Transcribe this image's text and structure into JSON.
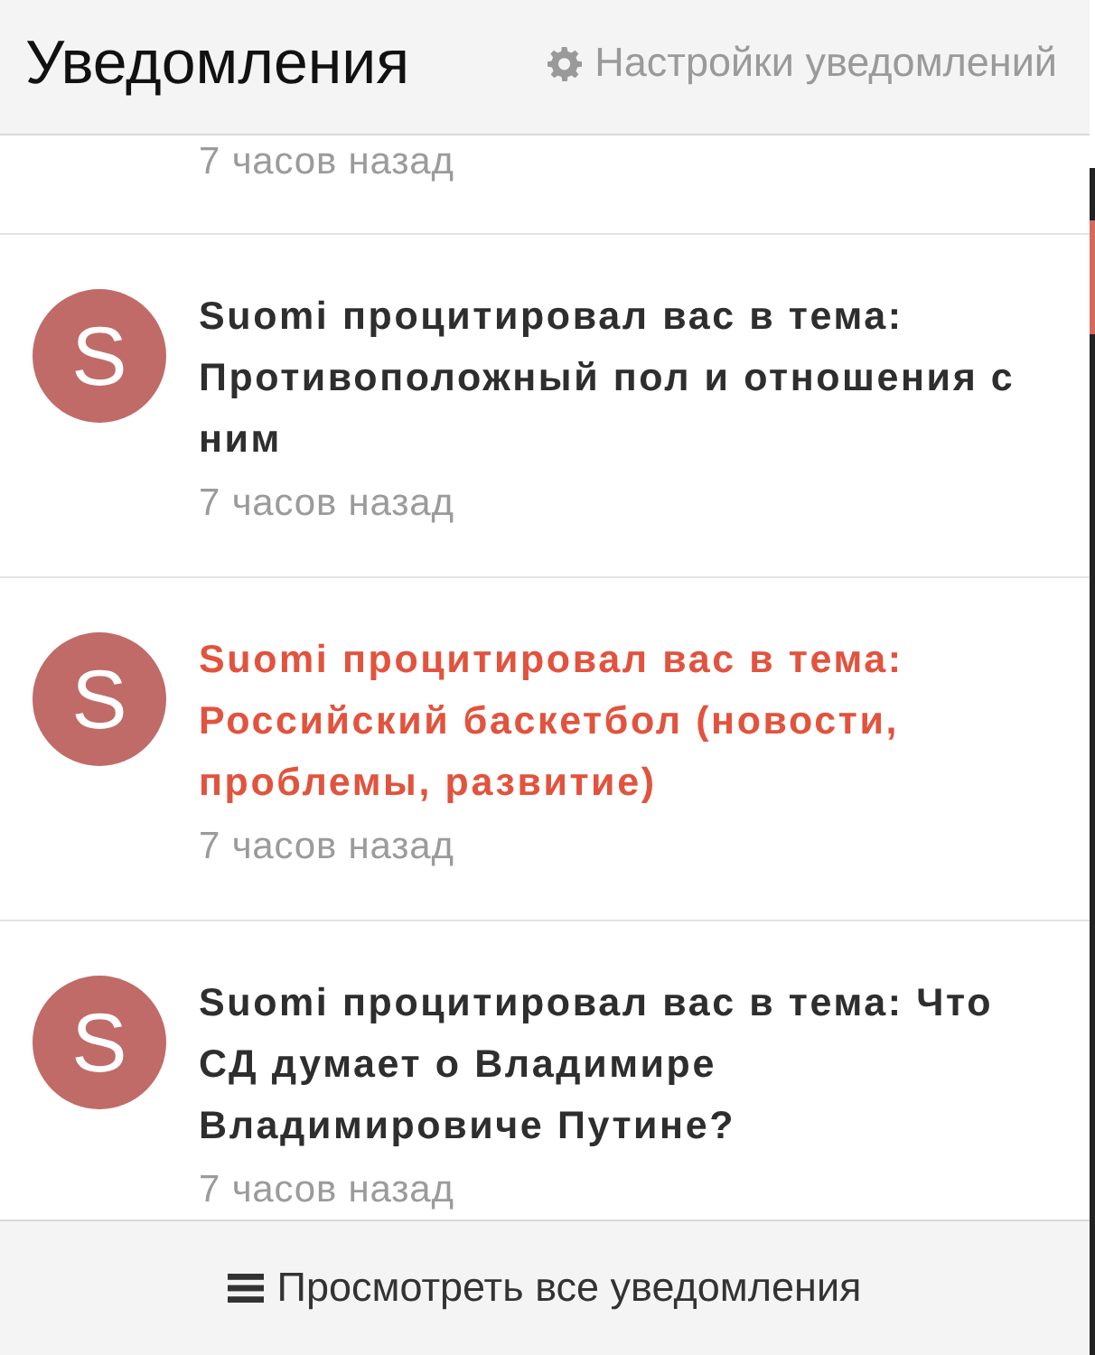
{
  "header": {
    "title": "Уведомления",
    "settings_link": "Настройки уведомлений"
  },
  "notifications": [
    {
      "time": "7 часов назад"
    },
    {
      "avatar": "S",
      "title": "Suomi процитировал вас в тема: Противоположный пол и отношения с ним",
      "time": "7 часов назад",
      "unread": false
    },
    {
      "avatar": "S",
      "title": "Suomi процитировал вас в тема: Российский баскетбол (новости, проблемы, развитие)",
      "time": "7 часов назад",
      "unread": true
    },
    {
      "avatar": "S",
      "title": "Suomi процитировал вас в тема: Что СД думает о Владимире Владимировиче Путине?",
      "time": "7 часов назад",
      "unread": false
    }
  ],
  "footer": {
    "link": "Просмотреть все уведомления"
  }
}
